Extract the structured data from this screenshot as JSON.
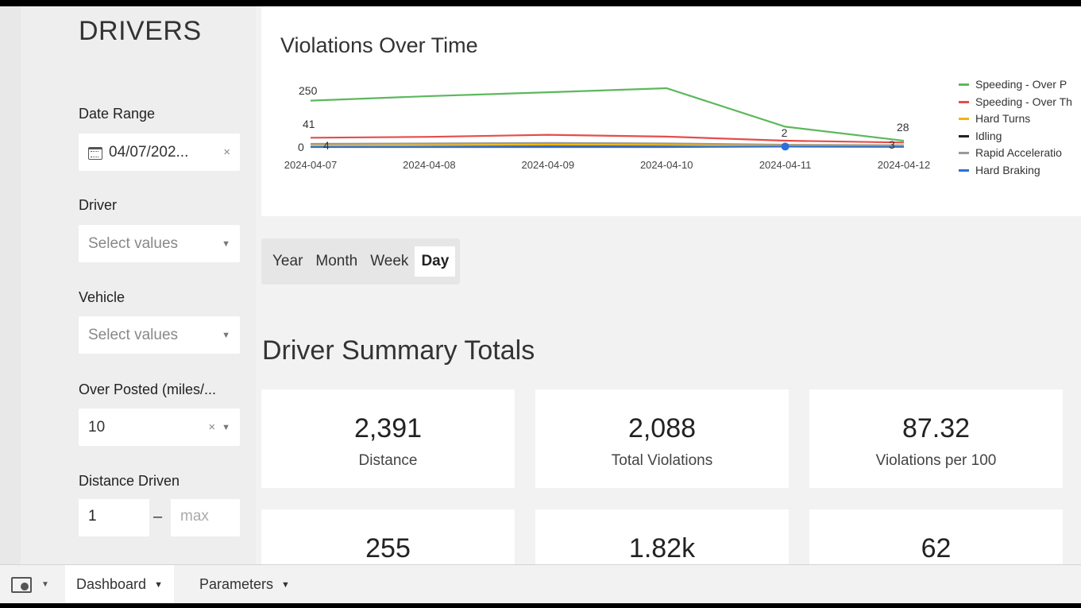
{
  "sidebar": {
    "title": "DRIVERS",
    "date_range": {
      "label": "Date Range",
      "value": "04/07/202...",
      "clear": "×"
    },
    "driver": {
      "label": "Driver",
      "placeholder": "Select values"
    },
    "vehicle": {
      "label": "Vehicle",
      "placeholder": "Select values"
    },
    "over_posted": {
      "label": "Over Posted (miles/...",
      "value": "10",
      "clear": "×"
    },
    "distance_driven": {
      "label": "Distance Driven",
      "min": "1",
      "dash": "–",
      "max": "max"
    }
  },
  "chart": {
    "title": "Violations Over Time",
    "annotations": [
      "250",
      "41",
      "0",
      "4",
      "2",
      "28",
      "3"
    ],
    "legend": [
      {
        "name": "Speeding - Over P",
        "color": "#5cb85c"
      },
      {
        "name": "Speeding - Over Th",
        "color": "#e74c4c"
      },
      {
        "name": "Hard Turns",
        "color": "#f4b400"
      },
      {
        "name": "Idling",
        "color": "#222222"
      },
      {
        "name": "Rapid Acceleratio",
        "color": "#999999"
      },
      {
        "name": "Hard Braking",
        "color": "#2a6fdb"
      }
    ]
  },
  "chart_data": {
    "type": "line",
    "title": "Violations Over Time",
    "x": [
      "2024-04-07",
      "2024-04-08",
      "2024-04-09",
      "2024-04-10",
      "2024-04-11",
      "2024-04-12"
    ],
    "ylim": [
      0,
      260
    ],
    "series": [
      {
        "name": "Speeding - Over P",
        "color": "#5cb85c",
        "values": [
          205,
          225,
          242,
          260,
          90,
          28
        ]
      },
      {
        "name": "Speeding - Over Th",
        "color": "#e74c4c",
        "values": [
          41,
          45,
          54,
          46,
          28,
          20
        ]
      },
      {
        "name": "Hard Turns",
        "color": "#f4b400",
        "values": [
          6,
          8,
          10,
          9,
          5,
          4
        ]
      },
      {
        "name": "Idling",
        "color": "#222222",
        "values": [
          4,
          6,
          8,
          7,
          4,
          3
        ]
      },
      {
        "name": "Rapid Acceleratio",
        "color": "#999999",
        "values": [
          14,
          16,
          18,
          16,
          10,
          8
        ]
      },
      {
        "name": "Hard Braking",
        "color": "#2a6fdb",
        "values": [
          0,
          0,
          0,
          0,
          2,
          1
        ]
      }
    ]
  },
  "granularity": {
    "options": [
      "Year",
      "Month",
      "Week",
      "Day"
    ],
    "selected": "Day"
  },
  "summary": {
    "title": "Driver Summary Totals",
    "cards": [
      {
        "value": "2,391",
        "label": "Distance"
      },
      {
        "value": "2,088",
        "label": "Total Violations"
      },
      {
        "value": "87.32",
        "label": "Violations per 100"
      },
      {
        "value": "255",
        "label": ""
      },
      {
        "value": "1.82k",
        "label": ""
      },
      {
        "value": "62",
        "label": ""
      }
    ]
  },
  "footer": {
    "tabs": [
      {
        "label": "Dashboard"
      },
      {
        "label": "Parameters"
      }
    ]
  }
}
